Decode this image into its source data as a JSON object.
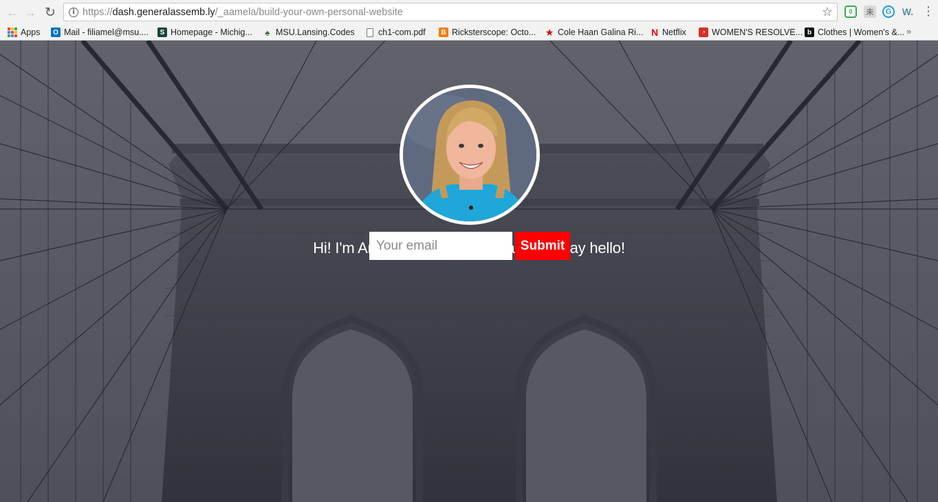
{
  "browser": {
    "url_scheme": "https://",
    "url_host": "dash.generalassemb.ly",
    "url_path": "/_aamela/build-your-own-personal-website",
    "extensions": [
      {
        "name": "evernote-extension-icon",
        "badge": "0"
      },
      {
        "name": "kanji-extension-icon",
        "label": "未"
      },
      {
        "name": "grammarly-extension-icon",
        "label": "G"
      },
      {
        "name": "wappalyzer-extension-icon",
        "label": "W."
      }
    ],
    "bookmarks_overflow": "»"
  },
  "bookmarks": [
    {
      "label": "Apps",
      "icon": "apps-grid-icon"
    },
    {
      "label": "Mail - filiamel@msu....",
      "icon": "outlook-icon",
      "color": "#0072c6",
      "glyph": "O"
    },
    {
      "label": "Homepage - Michig...",
      "icon": "msu-spartan-icon",
      "color": "#18453b",
      "glyph": "S"
    },
    {
      "label": "MSU.Lansing.Codes",
      "icon": "lansing-codes-icon",
      "color": "#4a6b3a",
      "glyph": "♠"
    },
    {
      "label": "ch1-com.pdf",
      "icon": "document-icon",
      "color": "#ffffff",
      "glyph": ""
    },
    {
      "label": "Ricksterscope: Octo...",
      "icon": "blogger-icon",
      "color": "#f57d00",
      "glyph": "B"
    },
    {
      "label": "Cole Haan Galina Ri...",
      "icon": "star-bookmark-icon",
      "color": "#d0021b",
      "glyph": "★"
    },
    {
      "label": "Netflix",
      "icon": "netflix-icon",
      "color": "#e50914",
      "glyph": "N"
    },
    {
      "label": "WOMEN'S RESOLVE...",
      "icon": "rss-icon",
      "color": "#d93025",
      "glyph": "◔"
    },
    {
      "label": "Clothes | Women's &...",
      "icon": "b-logo-icon",
      "color": "#111111",
      "glyph": "b"
    }
  ],
  "hero": {
    "headline": "Hi! I'm Anna, a NYC-based marketer. Say hello!",
    "email_placeholder": "Your email",
    "submit_label": "Submit"
  },
  "colors": {
    "submit": "#ff0000",
    "avatar_border": "#ffffff"
  }
}
